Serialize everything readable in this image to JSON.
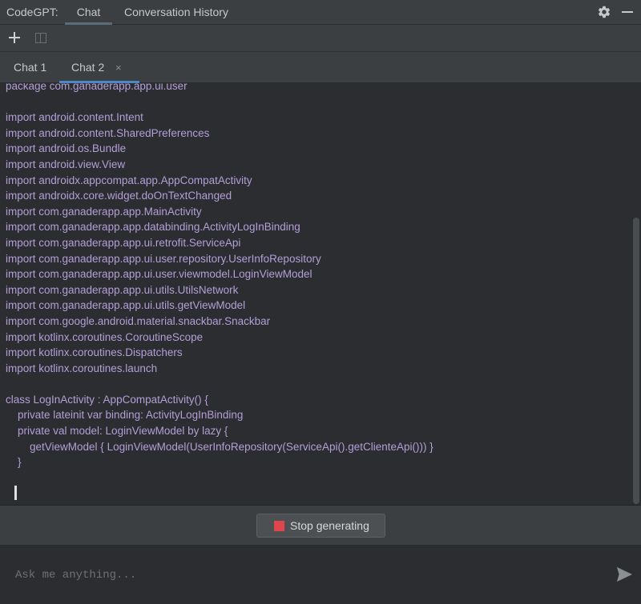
{
  "header": {
    "brand": "CodeGPT:",
    "tabs": [
      {
        "label": "Chat",
        "active": true
      },
      {
        "label": "Conversation History",
        "active": false
      }
    ],
    "icons": [
      "gear-icon",
      "minimize-icon"
    ]
  },
  "toolbar": {
    "icons": [
      "plus-icon",
      "split-panel-icon"
    ]
  },
  "chat_tabs": [
    {
      "label": "Chat 1",
      "active": false
    },
    {
      "label": "Chat 2",
      "active": true,
      "close_icon": "×"
    }
  ],
  "code": {
    "lines": [
      "package com.ganaderapp.app.ui.user",
      "",
      "import android.content.Intent",
      "import android.content.SharedPreferences",
      "import android.os.Bundle",
      "import android.view.View",
      "import androidx.appcompat.app.AppCompatActivity",
      "import androidx.core.widget.doOnTextChanged",
      "import com.ganaderapp.app.MainActivity",
      "import com.ganaderapp.app.databinding.ActivityLogInBinding",
      "import com.ganaderapp.app.ui.retrofit.ServiceApi",
      "import com.ganaderapp.app.ui.user.repository.UserInfoRepository",
      "import com.ganaderapp.app.ui.user.viewmodel.LoginViewModel",
      "import com.ganaderapp.app.ui.utils.UtilsNetwork",
      "import com.ganaderapp.app.ui.utils.getViewModel",
      "import com.google.android.material.snackbar.Snackbar",
      "import kotlinx.coroutines.CoroutineScope",
      "import kotlinx.coroutines.Dispatchers",
      "import kotlinx.coroutines.launch",
      "",
      "class LogInActivity : AppCompatActivity() {",
      "    private lateinit var binding: ActivityLogInBinding",
      "    private val model: LoginViewModel by lazy {",
      "        getViewModel { LoginViewModel(UserInfoRepository(ServiceApi().getClienteApi())) }",
      "    }"
    ],
    "text_color": "#b49fd8"
  },
  "stop_button": {
    "label": "Stop generating",
    "icon_color": "#e0454b"
  },
  "input": {
    "placeholder": "Ask me anything...",
    "value": ""
  },
  "colors": {
    "background": "#2b2d30",
    "panel": "#3c3f41",
    "accent": "#4a88c7"
  }
}
